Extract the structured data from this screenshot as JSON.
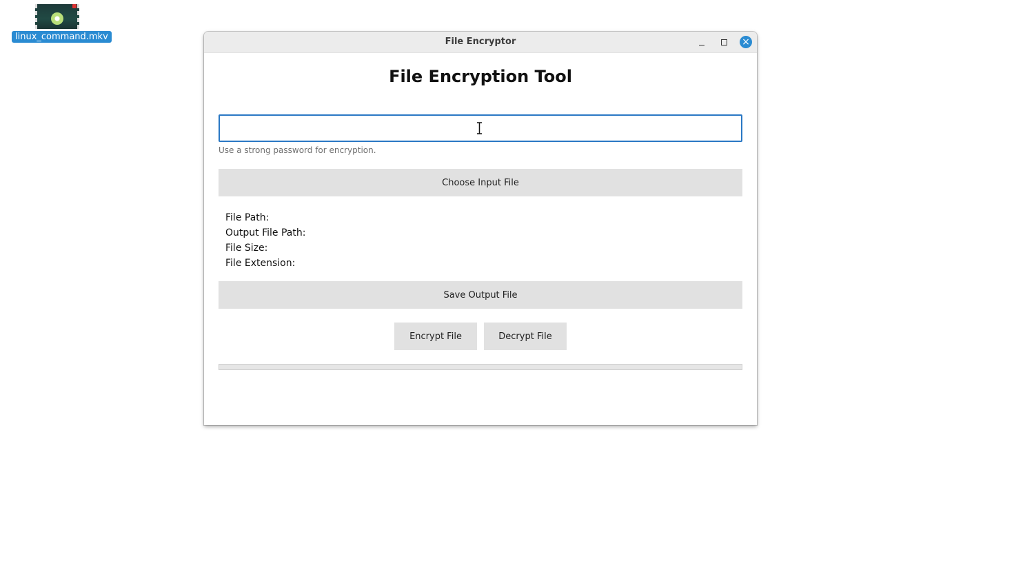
{
  "desktop": {
    "icon": {
      "label": "linux_command.mkv",
      "icon_name": "video-file-icon"
    }
  },
  "window": {
    "title": "File Encryptor",
    "controls": {
      "minimize": "minimize-icon",
      "maximize": "maximize-icon",
      "close": "close-icon",
      "close_color": "#2a8bd2"
    }
  },
  "app": {
    "heading": "File Encryption Tool",
    "password_input": {
      "value": "",
      "placeholder": ""
    },
    "password_hint": "Use a strong password for encryption.",
    "choose_button": "Choose Input File",
    "info": {
      "file_path_label": "File Path:",
      "output_path_label": "Output File Path:",
      "file_size_label": "File Size:",
      "file_extension_label": "File Extension:"
    },
    "save_button": "Save Output File",
    "encrypt_button": "Encrypt File",
    "decrypt_button": "Decrypt File",
    "progress": 0
  },
  "colors": {
    "accent": "#2a8bd2",
    "input_focus_border": "#2a78c4",
    "button_bg": "#e1e1e1"
  }
}
